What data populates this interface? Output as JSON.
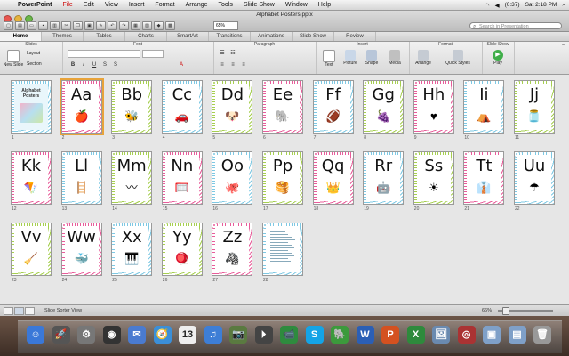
{
  "menubar": {
    "app": "PowerPoint",
    "items": [
      "File",
      "Edit",
      "View",
      "Insert",
      "Format",
      "Arrange",
      "Tools",
      "Slide Show",
      "Window",
      "Help"
    ],
    "battery": "(0:37)",
    "time": "Sat 2:18 PM"
  },
  "window": {
    "title": "Alphabet Posters.pptx",
    "zoom": "65%",
    "search_placeholder": "Search in Presentation"
  },
  "ribbon": {
    "tabs": [
      "Home",
      "Themes",
      "Tables",
      "Charts",
      "SmartArt",
      "Transitions",
      "Animations",
      "Slide Show",
      "Review"
    ],
    "groups": {
      "slides": "Slides",
      "font": "Font",
      "paragraph": "Paragraph",
      "insert": "Insert",
      "format": "Format",
      "slideshow": "Slide Show"
    },
    "buttons": {
      "new_slide": "New Slide",
      "layout": "Layout",
      "section": "Section",
      "text": "Text",
      "picture": "Picture",
      "shape": "Shape",
      "media": "Media",
      "arrange": "Arrange",
      "quick_styles": "Quick Styles",
      "play": "Play"
    }
  },
  "slides": [
    {
      "num": "1",
      "letter": "",
      "title": "Alphabet Posters",
      "kind": "cover",
      "icon": "cover-icon"
    },
    {
      "num": "2",
      "letter": "Aa",
      "icon": "apple-icon",
      "glyph": "🍎"
    },
    {
      "num": "3",
      "letter": "Bb",
      "icon": "bee-icon",
      "glyph": "🐝"
    },
    {
      "num": "4",
      "letter": "Cc",
      "icon": "car-icon",
      "glyph": "🚗"
    },
    {
      "num": "5",
      "letter": "Dd",
      "icon": "dog-icon",
      "glyph": "🐶"
    },
    {
      "num": "6",
      "letter": "Ee",
      "icon": "elephant-icon",
      "glyph": "🐘"
    },
    {
      "num": "7",
      "letter": "Ff",
      "icon": "football-icon",
      "glyph": "🏈"
    },
    {
      "num": "8",
      "letter": "Gg",
      "icon": "grapes-icon",
      "glyph": "🍇"
    },
    {
      "num": "9",
      "letter": "Hh",
      "icon": "heart-icon",
      "glyph": "♥"
    },
    {
      "num": "10",
      "letter": "Ii",
      "icon": "igloo-icon",
      "glyph": "⛺"
    },
    {
      "num": "11",
      "letter": "Jj",
      "icon": "jar-icon",
      "glyph": "🫙"
    },
    {
      "num": "12",
      "letter": "Kk",
      "icon": "kite-icon",
      "glyph": "🪁"
    },
    {
      "num": "13",
      "letter": "Ll",
      "icon": "ladder-icon",
      "glyph": "🪜"
    },
    {
      "num": "14",
      "letter": "Mm",
      "icon": "mustache-icon",
      "glyph": "〰"
    },
    {
      "num": "15",
      "letter": "Nn",
      "icon": "net-icon",
      "glyph": "🥅"
    },
    {
      "num": "16",
      "letter": "Oo",
      "icon": "octopus-icon",
      "glyph": "🐙"
    },
    {
      "num": "17",
      "letter": "Pp",
      "icon": "pancakes-icon",
      "glyph": "🥞"
    },
    {
      "num": "18",
      "letter": "Qq",
      "icon": "queen-icon",
      "glyph": "👑"
    },
    {
      "num": "19",
      "letter": "Rr",
      "icon": "robot-icon",
      "glyph": "🤖"
    },
    {
      "num": "20",
      "letter": "Ss",
      "icon": "sun-icon",
      "glyph": "☀"
    },
    {
      "num": "21",
      "letter": "Tt",
      "icon": "tie-icon",
      "glyph": "👔"
    },
    {
      "num": "22",
      "letter": "Uu",
      "icon": "umbrella-icon",
      "glyph": "☂"
    },
    {
      "num": "23",
      "letter": "Vv",
      "icon": "vacuum-icon",
      "glyph": "🧹"
    },
    {
      "num": "24",
      "letter": "Ww",
      "icon": "whale-icon",
      "glyph": "🐳"
    },
    {
      "num": "25",
      "letter": "Xx",
      "icon": "xylophone-icon",
      "glyph": "🎹"
    },
    {
      "num": "26",
      "letter": "Yy",
      "icon": "yoyo-icon",
      "glyph": "🪀"
    },
    {
      "num": "27",
      "letter": "Zz",
      "icon": "zebra-icon",
      "glyph": "🦓"
    },
    {
      "num": "28",
      "letter": "",
      "kind": "info",
      "icon": "info-page-icon"
    }
  ],
  "frame_colors": [
    "#7ec8e3",
    "#e85c9a",
    "#a6cf4f",
    "#7ec8e3",
    "#a6cf4f",
    "#e85c9a",
    "#7ec8e3",
    "#a6cf4f",
    "#e85c9a",
    "#7ec8e3",
    "#a6cf4f",
    "#e85c9a",
    "#7ec8e3",
    "#a6cf4f",
    "#e85c9a",
    "#7ec8e3",
    "#a6cf4f",
    "#e85c9a",
    "#7ec8e3",
    "#a6cf4f",
    "#e85c9a",
    "#7ec8e3",
    "#a6cf4f",
    "#e85c9a",
    "#7ec8e3",
    "#a6cf4f",
    "#e85c9a",
    "#7ec8e3"
  ],
  "status": {
    "view": "Slide Sorter View",
    "zoom": "66%"
  },
  "dock": [
    {
      "name": "finder-icon",
      "color": "#3a78d8",
      "glyph": "☺"
    },
    {
      "name": "launchpad-icon",
      "color": "#555",
      "glyph": "🚀"
    },
    {
      "name": "system-prefs-icon",
      "color": "#777",
      "glyph": "⚙"
    },
    {
      "name": "dashboard-icon",
      "color": "#333",
      "glyph": "◉"
    },
    {
      "name": "mail-icon",
      "color": "#4a7bd0",
      "glyph": "✉"
    },
    {
      "name": "safari-icon",
      "color": "#3b8fd8",
      "glyph": "🧭"
    },
    {
      "name": "calendar-icon",
      "color": "#eeeeee",
      "glyph": "13"
    },
    {
      "name": "itunes-icon",
      "color": "#3d7ed6",
      "glyph": "♫"
    },
    {
      "name": "iphoto-icon",
      "color": "#5a7a40",
      "glyph": "📷"
    },
    {
      "name": "quicktime-icon",
      "color": "#444",
      "glyph": "⏵"
    },
    {
      "name": "facetime-icon",
      "color": "#2e8b3e",
      "glyph": "📹"
    },
    {
      "name": "skype-icon",
      "color": "#14a4e6",
      "glyph": "S"
    },
    {
      "name": "evernote-icon",
      "color": "#3c9a3c",
      "glyph": "🐘"
    },
    {
      "name": "word-icon",
      "color": "#2b5fb5",
      "glyph": "W"
    },
    {
      "name": "powerpoint-icon",
      "color": "#d45120",
      "glyph": "P"
    },
    {
      "name": "excel-icon",
      "color": "#2e8a3c",
      "glyph": "X"
    },
    {
      "name": "preview-icon",
      "color": "#6a8ab0",
      "glyph": "🖼"
    },
    {
      "name": "photo-booth-icon",
      "color": "#a33",
      "glyph": "◎"
    },
    {
      "name": "applications-folder-icon",
      "color": "#7fa0c8",
      "glyph": "▣"
    },
    {
      "name": "documents-folder-icon",
      "color": "#7fa0c8",
      "glyph": "▤"
    },
    {
      "name": "trash-icon",
      "color": "#999",
      "glyph": "🗑"
    }
  ]
}
